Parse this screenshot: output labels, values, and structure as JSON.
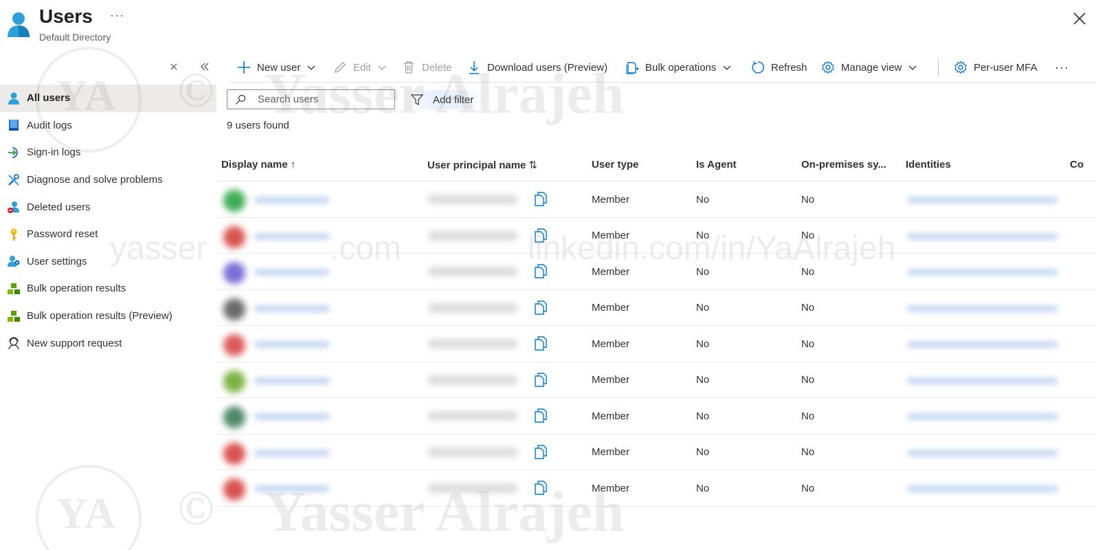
{
  "header": {
    "title": "Users",
    "subtitle": "Default Directory",
    "more_label": "···"
  },
  "sidebar": {
    "items": [
      {
        "label": "All users",
        "icon": "user-icon",
        "active": true
      },
      {
        "label": "Audit logs",
        "icon": "book-icon"
      },
      {
        "label": "Sign-in logs",
        "icon": "sign-in-icon"
      },
      {
        "label": "Diagnose and solve problems",
        "icon": "wrench-icon"
      },
      {
        "label": "Deleted users",
        "icon": "deleted-user-icon"
      },
      {
        "label": "Password reset",
        "icon": "key-icon"
      },
      {
        "label": "User settings",
        "icon": "user-settings-icon"
      },
      {
        "label": "Bulk operation results",
        "icon": "cubes-icon"
      },
      {
        "label": "Bulk operation results (Preview)",
        "icon": "cubes-icon"
      },
      {
        "label": "New support request",
        "icon": "support-icon"
      }
    ]
  },
  "toolbar": {
    "new_user": "New user",
    "edit": "Edit",
    "delete": "Delete",
    "download": "Download users (Preview)",
    "bulk": "Bulk operations",
    "refresh": "Refresh",
    "manage_view": "Manage view",
    "per_user_mfa": "Per-user MFA",
    "more": "···"
  },
  "search": {
    "placeholder": "Search users"
  },
  "filter": {
    "label": "Add filter"
  },
  "results": {
    "count_label": "9 users found"
  },
  "table": {
    "columns": {
      "display_name": "Display name",
      "display_name_sort": "↑",
      "upn": "User principal name",
      "upn_sort": "⇅",
      "user_type": "User type",
      "is_agent": "Is Agent",
      "on_prem": "On-premises sy...",
      "identities": "Identities",
      "next": "Co"
    },
    "rows": [
      {
        "user_type": "Member",
        "is_agent": "No",
        "on_prem": "No",
        "avatar_color": "#3fae55"
      },
      {
        "user_type": "Member",
        "is_agent": "No",
        "on_prem": "No",
        "avatar_color": "#d9534f"
      },
      {
        "user_type": "Member",
        "is_agent": "No",
        "on_prem": "No",
        "avatar_color": "#7b6fd6"
      },
      {
        "user_type": "Member",
        "is_agent": "No",
        "on_prem": "No",
        "avatar_color": "#6b6b6b"
      },
      {
        "user_type": "Member",
        "is_agent": "No",
        "on_prem": "No",
        "avatar_color": "#dc5b5b"
      },
      {
        "user_type": "Member",
        "is_agent": "No",
        "on_prem": "No",
        "avatar_color": "#7cb342"
      },
      {
        "user_type": "Member",
        "is_agent": "No",
        "on_prem": "No",
        "avatar_color": "#4f8a6a"
      },
      {
        "user_type": "Member",
        "is_agent": "No",
        "on_prem": "No",
        "avatar_color": "#d9534f"
      },
      {
        "user_type": "Member",
        "is_agent": "No",
        "on_prem": "No",
        "avatar_color": "#d9534f"
      }
    ]
  },
  "watermark": {
    "name": "Yasser Alrajeh",
    "copyright": "©",
    "initials": "YA",
    "email_part": "yasser",
    "domain_part": ".com",
    "linkedin": "linkedin.com/in/YaAlrajeh"
  },
  "colors": {
    "accent": "#0078d4",
    "active_bg": "#edebe9"
  }
}
